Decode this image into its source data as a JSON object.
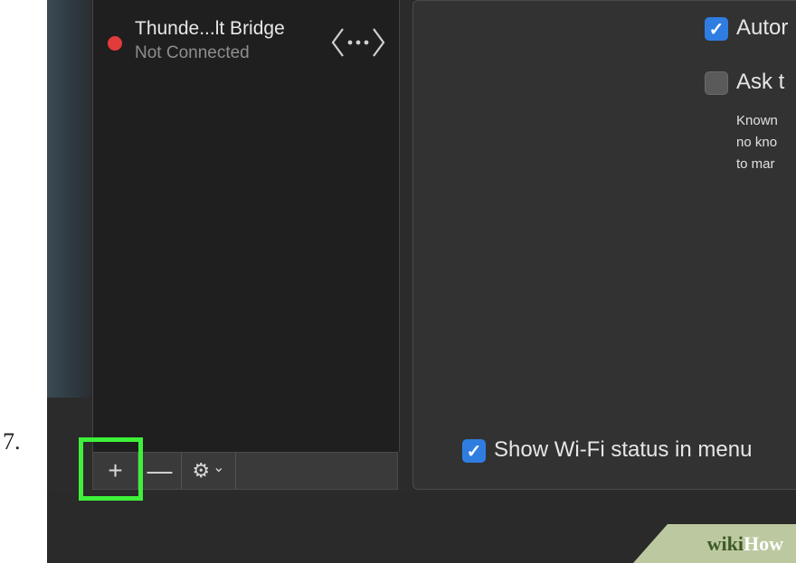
{
  "step": {
    "number": "7."
  },
  "service_list": {
    "items": [
      {
        "name": "Thunde...lt Bridge",
        "status": "Not Connected",
        "status_color": "#e23b3b",
        "icon": "bridge-icon"
      }
    ]
  },
  "toolbar": {
    "add_label": "+",
    "remove_label": "—",
    "gear_label": "⚙",
    "gear_chevron": "⌄"
  },
  "detail": {
    "auto_join_label": "Autor",
    "auto_join_checked": true,
    "ask_label": "Ask t",
    "ask_checked": false,
    "description_lines": [
      "Known",
      "no kno",
      "to mar"
    ],
    "show_wifi_label": "Show Wi-Fi status in menu",
    "show_wifi_checked": true
  },
  "watermark": {
    "wiki": "wiki",
    "how": "How"
  },
  "colors": {
    "accent_highlight": "#3ef03a",
    "checkbox_blue": "#2f7de1"
  }
}
